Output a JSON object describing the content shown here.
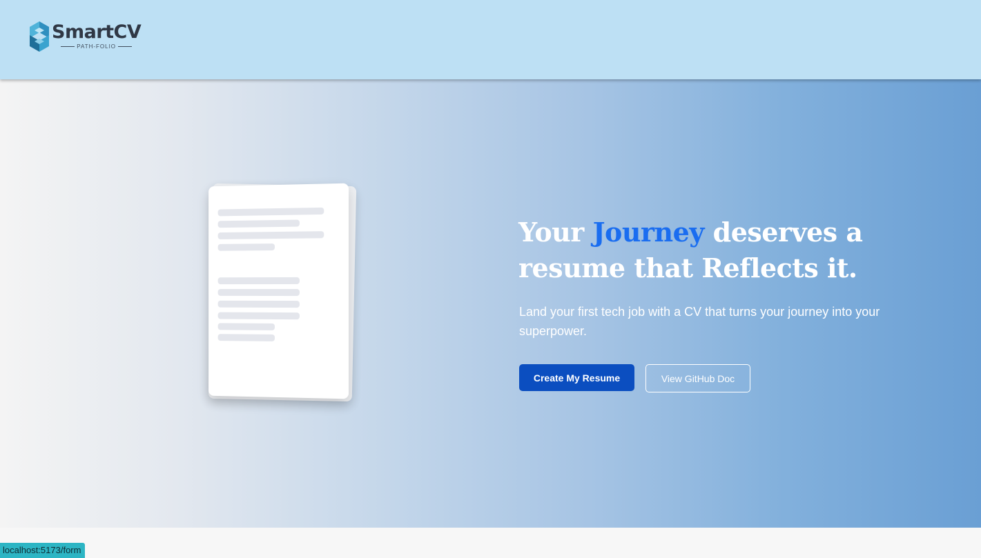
{
  "header": {
    "logo_name": "SmartCV",
    "logo_tagline": "PATH-FOLIO"
  },
  "hero": {
    "headline_before": "Your ",
    "headline_accent": "Journey",
    "headline_after": " deserves a resume that Reflects it.",
    "subtext": "Land your first tech job with a CV that turns your journey into your superpower.",
    "primary_button": "Create My Resume",
    "secondary_button": "View GitHub Doc",
    "accent_color": "#1a6df0",
    "primary_color": "#0b4ec0"
  },
  "status_bar": {
    "url": "localhost:5173/form"
  }
}
